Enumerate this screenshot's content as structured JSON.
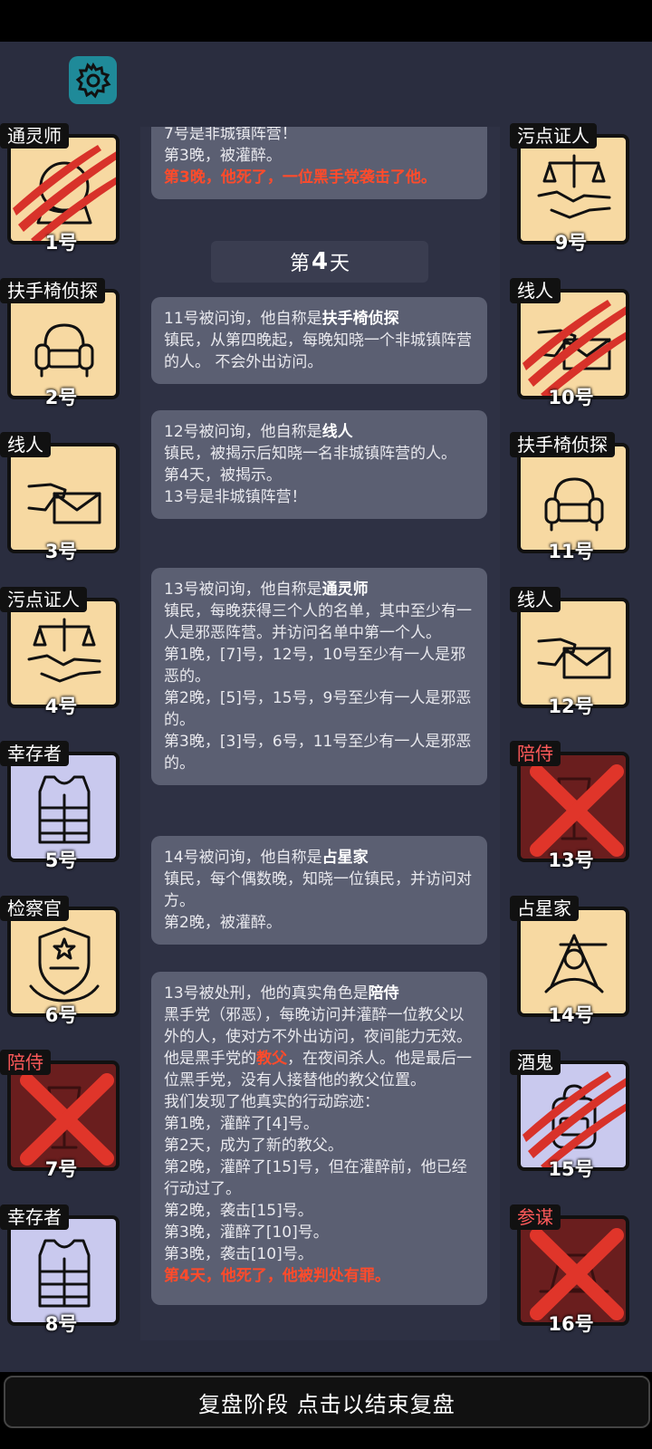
{
  "settings": {
    "icon": "gear-icon"
  },
  "left_players": [
    {
      "role": "通灵师",
      "number": "1号",
      "theme": "orange",
      "icon": "crystal-ball-icon",
      "state": "clawed"
    },
    {
      "role": "扶手椅侦探",
      "number": "2号",
      "theme": "orange",
      "icon": "armchair-icon",
      "state": "alive"
    },
    {
      "role": "线人",
      "number": "3号",
      "theme": "orange",
      "icon": "envelope-hand-icon",
      "state": "alive"
    },
    {
      "role": "污点证人",
      "number": "4号",
      "theme": "orange",
      "icon": "scales-handshake-icon",
      "state": "alive"
    },
    {
      "role": "幸存者",
      "number": "5号",
      "theme": "lavender",
      "icon": "vest-icon",
      "state": "alive"
    },
    {
      "role": "检察官",
      "number": "6号",
      "theme": "orange",
      "icon": "prosecutor-badge-icon",
      "state": "alive"
    },
    {
      "role": "陪侍",
      "number": "7号",
      "theme": "dead",
      "icon": "wine-glass-icon",
      "state": "crossed"
    },
    {
      "role": "幸存者",
      "number": "8号",
      "theme": "lavender",
      "icon": "vest-icon",
      "state": "alive"
    }
  ],
  "right_players": [
    {
      "role": "污点证人",
      "number": "9号",
      "theme": "orange",
      "icon": "scales-handshake-icon",
      "state": "alive"
    },
    {
      "role": "线人",
      "number": "10号",
      "theme": "orange",
      "icon": "envelope-hand-icon",
      "state": "clawed"
    },
    {
      "role": "扶手椅侦探",
      "number": "11号",
      "theme": "orange",
      "icon": "armchair-icon",
      "state": "alive"
    },
    {
      "role": "线人",
      "number": "12号",
      "theme": "orange",
      "icon": "envelope-hand-icon",
      "state": "alive"
    },
    {
      "role": "陪侍",
      "number": "13号",
      "theme": "dead",
      "icon": "wine-glass-icon",
      "state": "crossed"
    },
    {
      "role": "占星家",
      "number": "14号",
      "theme": "orange",
      "icon": "sextant-icon",
      "state": "alive"
    },
    {
      "role": "酒鬼",
      "number": "15号",
      "theme": "lavender",
      "icon": "backpack-icon",
      "state": "clawed"
    },
    {
      "role": "参谋",
      "number": "16号",
      "theme": "dead",
      "icon": "hat-icon",
      "state": "crossed"
    }
  ],
  "log": {
    "top_msg": {
      "lines": [
        "7号是非城镇阵营！",
        "第3晚，被灌醉。"
      ],
      "red": "第3晚，他死了，一位黑手党袭击了他。"
    },
    "day_prefix": "第",
    "day_num": "4",
    "day_suffix": "天",
    "msg1": {
      "prefix": "11号被问询，他自称是",
      "role": "扶手椅侦探",
      "desc": "镇民，从第四晚起，每晚知晓一个非城镇阵营的人。 不会外出访问。"
    },
    "msg2": {
      "prefix": "12号被问询，他自称是",
      "role": "线人",
      "lines": [
        "镇民，被揭示后知晓一名非城镇阵营的人。",
        "第4天，被揭示。",
        "13号是非城镇阵营！"
      ]
    },
    "msg3": {
      "prefix": "13号被问询，他自称是",
      "role": "通灵师",
      "lines": [
        "镇民，每晚获得三个人的名单，其中至少有一人是邪恶阵营。并访问名单中第一个人。",
        "第1晚，[7]号，12号，10号至少有一人是邪恶的。",
        "第2晚，[5]号，15号，9号至少有一人是邪恶的。",
        "第3晚，[3]号，6号，11号至少有一人是邪恶的。"
      ]
    },
    "msg4": {
      "prefix": "14号被问询，他自称是",
      "role": "占星家",
      "lines": [
        "镇民，每个偶数晚，知晓一位镇民，并访问对方。",
        "第2晚，被灌醉。"
      ]
    },
    "msg5": {
      "prefix": "13号被处刑，他的真实角色是",
      "role": "陪侍",
      "desc": "黑手党（邪恶），每晚访问并灌醉一位教父以外的人，使对方不外出访问，夜间能力无效。",
      "godfather_pre": "他是黑手党的",
      "godfather_role": "教父",
      "godfather_post": "，在夜间杀人。他是最后一位黑手党，没有人接替他的教父位置。",
      "lines": [
        "我们发现了他真实的行动踪迹：",
        "第1晚，灌醉了[4]号。",
        "第2天，成为了新的教父。",
        "第2晚，灌醉了[15]号，但在灌醉前，他已经行动过了。",
        "第2晚，袭击[15]号。",
        "第3晚，灌醉了[10]号。",
        "第3晚，袭击[10]号。"
      ],
      "red": "第4天，他死了，他被判处有罪。"
    }
  },
  "footer": {
    "label": "复盘阶段 点击以结束复盘"
  }
}
